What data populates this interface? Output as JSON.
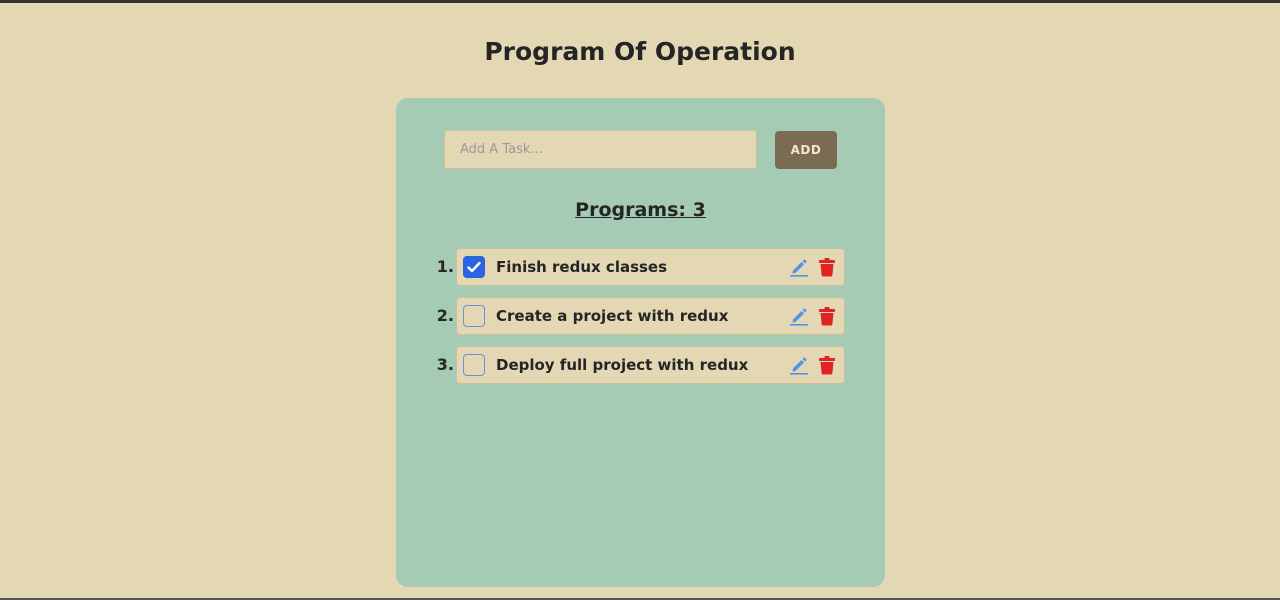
{
  "header": {
    "title": "Program Of Operation"
  },
  "form": {
    "input_placeholder": "Add A Task...",
    "input_value": "",
    "add_label": "ADD"
  },
  "summary": {
    "count_label": "Programs: 3"
  },
  "tasks": [
    {
      "number": "1.",
      "text": "Finish redux classes",
      "completed": true
    },
    {
      "number": "2.",
      "text": "Create a project with redux",
      "completed": false
    },
    {
      "number": "3.",
      "text": "Deploy full project with redux",
      "completed": false
    }
  ],
  "icons": {
    "edit": "pencil-icon",
    "delete": "trash-icon",
    "check": "checkmark-icon"
  },
  "colors": {
    "page_background": "#e3d7b4",
    "card_background": "#a5cbb4",
    "add_button": "#7a6b52",
    "checkbox_checked": "#2b63e3",
    "edit_icon": "#5b8fe6",
    "delete_icon": "#e02424"
  }
}
